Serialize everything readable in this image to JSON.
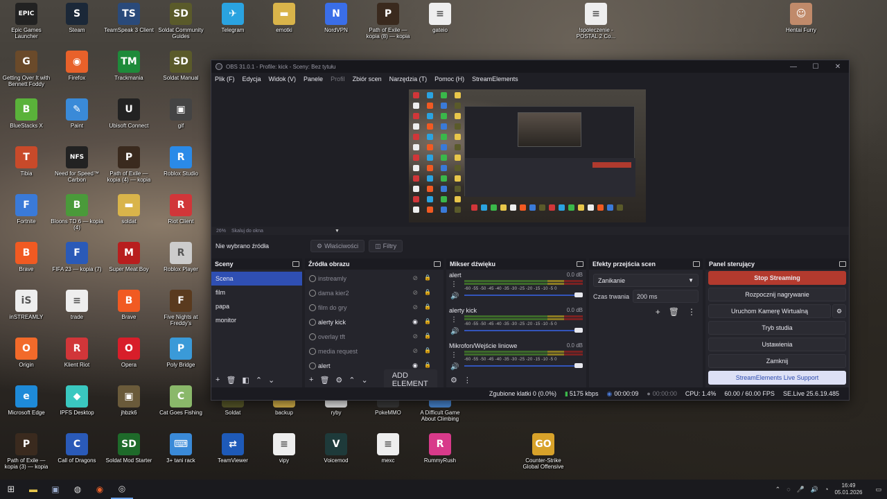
{
  "desktop": {
    "icons": [
      {
        "label": "Epic Games Launcher",
        "glyph": "EPIC",
        "color": "#222222"
      },
      {
        "label": "Steam",
        "glyph": "S",
        "color": "#1b2838"
      },
      {
        "label": "TeamSpeak 3 Client",
        "glyph": "TS",
        "color": "#2a4a7a"
      },
      {
        "label": "Soldat Community Guides",
        "glyph": "SD",
        "color": "#5a5a2a"
      },
      {
        "label": "Telegram",
        "glyph": "✈",
        "color": "#2aa3e0"
      },
      {
        "label": "emotki",
        "glyph": "▬",
        "color": "#d9b44a"
      },
      {
        "label": "NordVPN",
        "glyph": "N",
        "color": "#3a6ee8"
      },
      {
        "label": "Path of Exile — kopia (8) — kopia",
        "glyph": "P",
        "color": "#3a2a1e"
      },
      {
        "label": "gateio",
        "glyph": "≡",
        "color": "#eeeeee"
      },
      {
        "label": "!społeczenie - POSTAL 2 Co...",
        "glyph": "≡",
        "color": "#eeeeee"
      },
      {
        "label": "Hentai Furry",
        "glyph": "☺",
        "color": "#c08a6a"
      },
      {
        "label": "Getting Over It with Bennett Foddy",
        "glyph": "G",
        "color": "#6a4a2a"
      },
      {
        "label": "Firefox",
        "glyph": "◉",
        "color": "#e8612a"
      },
      {
        "label": "Trackmania",
        "glyph": "TM",
        "color": "#1e8a3a"
      },
      {
        "label": "Soldat Manual",
        "glyph": "SD",
        "color": "#5a5a2a"
      },
      {
        "label": "BlueStacks X",
        "glyph": "B",
        "color": "#5ab23a"
      },
      {
        "label": "Paint",
        "glyph": "✎",
        "color": "#3a8ad8"
      },
      {
        "label": "Ubisoft Connect",
        "glyph": "U",
        "color": "#222222"
      },
      {
        "label": "gif",
        "glyph": "▣",
        "color": "#444444"
      },
      {
        "label": "Tibia",
        "glyph": "T",
        "color": "#c84a2a"
      },
      {
        "label": "Need for Speed™ Carbon",
        "glyph": "NFS",
        "color": "#222222"
      },
      {
        "label": "Path of Exile — kopia (4) — kopia",
        "glyph": "P",
        "color": "#3a2a1e"
      },
      {
        "label": "Roblox Studio",
        "glyph": "R",
        "color": "#2a8ae8"
      },
      {
        "label": "Fortnite",
        "glyph": "F",
        "color": "#3a7ad8"
      },
      {
        "label": "Bloons TD 6 — kopia (4)",
        "glyph": "B",
        "color": "#4a9a3a"
      },
      {
        "label": "soldat",
        "glyph": "▬",
        "color": "#d9b44a"
      },
      {
        "label": "Riot Client",
        "glyph": "R",
        "color": "#d13639"
      },
      {
        "label": "Brave",
        "glyph": "B",
        "color": "#f15a22"
      },
      {
        "label": "FIFA 23 — kopia (7)",
        "glyph": "F",
        "color": "#2a5ab8"
      },
      {
        "label": "Super Meat Boy",
        "glyph": "M",
        "color": "#b81e1e"
      },
      {
        "label": "Roblox Player",
        "glyph": "R",
        "color": "#cccccc"
      },
      {
        "label": "inSTREAMLY",
        "glyph": "iS",
        "color": "#eeeeee"
      },
      {
        "label": "trade",
        "glyph": "≡",
        "color": "#eeeeee"
      },
      {
        "label": "Brave",
        "glyph": "B",
        "color": "#f15a22"
      },
      {
        "label": "Five Nights at Freddy's",
        "glyph": "F",
        "color": "#5a3a1e"
      },
      {
        "label": "Origin",
        "glyph": "O",
        "color": "#f26a2a"
      },
      {
        "label": "Klient Riot",
        "glyph": "R",
        "color": "#d13639"
      },
      {
        "label": "Opera",
        "glyph": "O",
        "color": "#d81e2a"
      },
      {
        "label": "Poly Bridge",
        "glyph": "P",
        "color": "#3a9ad8"
      },
      {
        "label": "Microsoft Edge",
        "glyph": "e",
        "color": "#1e8ad8"
      },
      {
        "label": "IPFS Desktop",
        "glyph": "◆",
        "color": "#3ac8c0"
      },
      {
        "label": "jhbzk6",
        "glyph": "▣",
        "color": "#6a5a3a"
      },
      {
        "label": "Cat Goes Fishing",
        "glyph": "C",
        "color": "#8ab86a"
      },
      {
        "label": "Soldat",
        "glyph": "SD",
        "color": "#5a5a2a"
      },
      {
        "label": "backup",
        "glyph": "▬",
        "color": "#d9b44a"
      },
      {
        "label": "ryby",
        "glyph": "≡",
        "color": "#eeeeee"
      },
      {
        "label": "PokeMMO",
        "glyph": "P",
        "color": "#3a3a3a"
      },
      {
        "label": "A Difficult Game About Climbing",
        "glyph": "A",
        "color": "#4a8ad8"
      },
      {
        "label": "Path of Exile — kopia (3) — kopia",
        "glyph": "P",
        "color": "#3a2a1e"
      },
      {
        "label": "Call of Dragons",
        "glyph": "C",
        "color": "#2a5ab8"
      },
      {
        "label": "Soldat Mod Starter",
        "glyph": "SD",
        "color": "#1e6a2a"
      },
      {
        "label": "3+ tani rack",
        "glyph": "⌨",
        "color": "#3a8ad8"
      },
      {
        "label": "TeamViewer",
        "glyph": "⇄",
        "color": "#1e5ab8"
      },
      {
        "label": "vipy",
        "glyph": "≡",
        "color": "#eeeeee"
      },
      {
        "label": "Voicemod",
        "glyph": "V",
        "color": "#1e3a3a"
      },
      {
        "label": "mexc",
        "glyph": "≡",
        "color": "#eeeeee"
      },
      {
        "label": "RummyRush",
        "glyph": "R",
        "color": "#d83a8a"
      },
      {
        "label": "Counter-Strike Global Offensive",
        "glyph": "GO",
        "color": "#d8a22a"
      }
    ]
  },
  "obs": {
    "title": "OBS 31.0.1 - Profile: kick - Sceny: Bez tytułu",
    "window_controls": [
      "—",
      "☐",
      "✕"
    ],
    "menu": [
      {
        "label": "Plik (F)",
        "dim": false
      },
      {
        "label": "Edycja",
        "dim": false
      },
      {
        "label": "Widok (V)",
        "dim": false
      },
      {
        "label": "Panele",
        "dim": false
      },
      {
        "label": "Profil",
        "dim": true
      },
      {
        "label": "Zbiór scen",
        "dim": false
      },
      {
        "label": "Narzędzia (T)",
        "dim": false
      },
      {
        "label": "Pomoc (H)",
        "dim": false
      },
      {
        "label": "StreamElements",
        "dim": false
      }
    ],
    "zoom": "26%",
    "scale_mode": "Skaluj do okna",
    "no_source": "Nie wybrano źródła",
    "properties_btn": "Właściwości",
    "filters_btn": "Filtry",
    "scenes": {
      "title": "Sceny",
      "items": [
        "Scena",
        "film",
        "papa",
        "monitor"
      ],
      "selected": 0
    },
    "sources": {
      "title": "Źródła obrazu",
      "items": [
        {
          "label": "instreamly",
          "visible": false
        },
        {
          "label": "dama kier2",
          "visible": false
        },
        {
          "label": "film do gry",
          "visible": false
        },
        {
          "label": "alerty kick",
          "visible": true
        },
        {
          "label": "overlay tft",
          "visible": false
        },
        {
          "label": "media request",
          "visible": false
        },
        {
          "label": "alert",
          "visible": true
        }
      ],
      "add_element": "ADD ELEMENT"
    },
    "mixer": {
      "title": "Mikser dźwięku",
      "scale": "-60 -55 -50 -45 -40 -35 -30 -25 -20 -15 -10 -5 0",
      "channels": [
        {
          "name": "alert",
          "db": "0.0 dB"
        },
        {
          "name": "alerty kick",
          "db": "0.0 dB"
        },
        {
          "name": "Mikrofon/Wejście liniowe",
          "db": "0.0 dB"
        }
      ]
    },
    "transitions": {
      "title": "Efekty przejścia scen",
      "selected": "Zanikanie",
      "duration_label": "Czas trwania",
      "duration_value": "200 ms"
    },
    "controls": {
      "title": "Panel sterujący",
      "stop_streaming": "Stop Streaming",
      "start_recording": "Rozpocznij nagrywanie",
      "virtual_camera": "Uruchom Kamerę Wirtualną",
      "studio_mode": "Tryb studia",
      "settings": "Ustawienia",
      "exit": "Zamknij",
      "support": "StreamElements Live Support"
    },
    "status": {
      "dropped_frames": "Zgubione klatki 0 (0.0%)",
      "bitrate": "5175 kbps",
      "stream_time": "00:00:09",
      "rec_time": "00:00:00",
      "cpu": "CPU: 1.4%",
      "fps": "60.00 / 60.00 FPS",
      "version": "SE.Live 25.6.19.485"
    }
  },
  "taskbar": {
    "time": "16:49",
    "date": "05.01.2026"
  }
}
